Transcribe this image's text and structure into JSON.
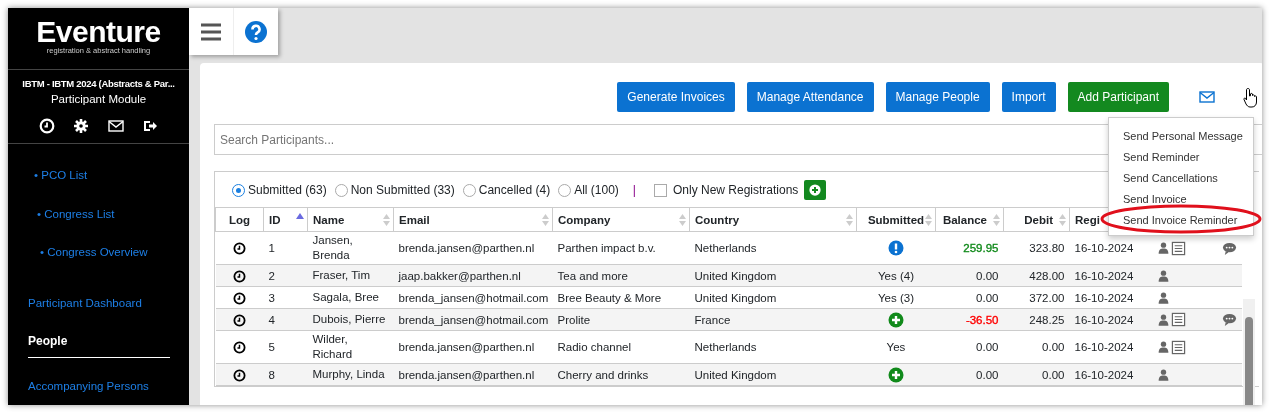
{
  "sidebar": {
    "logo": "Eventure",
    "tagline": "registration & abstract handling",
    "event": "IBTM - IBTM 2024 (Abstracts & Par...",
    "module": "Participant Module",
    "tree": [
      {
        "label": "• PCO List",
        "children": [
          {
            "label": "• Congress List",
            "children": [
              {
                "label": "• Congress Overview"
              }
            ]
          }
        ]
      }
    ],
    "menu": [
      {
        "label": "Participant Dashboard",
        "selected": false
      },
      {
        "label": "People",
        "selected": true
      },
      {
        "label": "Accompanying Persons",
        "selected": false
      }
    ]
  },
  "actions": [
    {
      "label": "Generate Invoices",
      "kind": "primary"
    },
    {
      "label": "Manage Attendance",
      "kind": "primary"
    },
    {
      "label": "Manage People",
      "kind": "primary"
    },
    {
      "label": "Import",
      "kind": "primary"
    },
    {
      "label": "Add Participant",
      "kind": "success"
    }
  ],
  "mail_menu": {
    "expanded": true,
    "items": [
      {
        "label": "Send Personal Message",
        "highlighted": false
      },
      {
        "label": "Send Reminder",
        "highlighted": false
      },
      {
        "label": "Send Cancellations",
        "highlighted": false
      },
      {
        "label": "Send Invoice",
        "highlighted": false
      },
      {
        "label": "Send Invoice Reminder",
        "highlighted": true
      }
    ]
  },
  "search": {
    "placeholder": "Search Participants..."
  },
  "filters": [
    {
      "label": "Submitted (63)",
      "selected": true
    },
    {
      "label": "Non Submitted (33)",
      "selected": false
    },
    {
      "label": "Cancelled (4)",
      "selected": false
    },
    {
      "label": "All (100)",
      "selected": false
    }
  ],
  "separator": "|",
  "new_only": {
    "label": "Only New Registrations",
    "checked": false
  },
  "table": {
    "columns": [
      {
        "label": "Log",
        "sortable": false
      },
      {
        "label": "ID",
        "sorted": true
      },
      {
        "label": "Name",
        "sortable": true
      },
      {
        "label": "Email",
        "sortable": true
      },
      {
        "label": "Company",
        "sortable": true
      },
      {
        "label": "Country",
        "sortable": true
      },
      {
        "label": "Submitted",
        "sortable": true
      },
      {
        "label": "Balance",
        "sortable": true
      },
      {
        "label": "Debit",
        "sortable": true
      },
      {
        "label": "Regi",
        "sortable": false
      }
    ],
    "rows": [
      {
        "id": "1",
        "name": "Jansen, Brenda",
        "email": "brenda.jansen@parthen.nl",
        "company": "Parthen impact b.v.",
        "country": "Netherlands",
        "submitted": {
          "kind": "alert"
        },
        "balance": {
          "text": "259.95",
          "color": "#118a1b"
        },
        "debit": "323.80",
        "registered": "16-10-2024",
        "has_form": true,
        "has_comment": true
      },
      {
        "id": "2",
        "name": "Fraser, Tim",
        "email": "jaap.bakker@parthen.nl",
        "company": "Tea and more",
        "country": "United Kingdom",
        "submitted": {
          "kind": "text",
          "text": "Yes (4)"
        },
        "balance": {
          "text": "0.00"
        },
        "debit": "428.00",
        "registered": "16-10-2024",
        "has_form": false,
        "has_comment": false
      },
      {
        "id": "3",
        "name": "Sagala, Bree",
        "email": "brenda_jansen@hotmail.com",
        "company": "Bree Beauty & More",
        "country": "United Kingdom",
        "submitted": {
          "kind": "text",
          "text": "Yes (3)"
        },
        "balance": {
          "text": "0.00"
        },
        "debit": "372.00",
        "registered": "16-10-2024",
        "has_form": false,
        "has_comment": false
      },
      {
        "id": "4",
        "name": "Dubois, Pierre",
        "email": "brenda_jansen@hotmail.com",
        "company": "Prolite",
        "country": "France",
        "submitted": {
          "kind": "plus"
        },
        "balance": {
          "text": "-36.50",
          "color": "#ff0000"
        },
        "debit": "248.25",
        "registered": "16-10-2024",
        "has_form": true,
        "has_comment": true
      },
      {
        "id": "5",
        "name": "Wilder, Richard",
        "email": "brenda.jansen@parthen.nl",
        "company": "Radio channel",
        "country": "Netherlands",
        "submitted": {
          "kind": "text",
          "text": "Yes"
        },
        "balance": {
          "text": "0.00"
        },
        "debit": "0.00",
        "registered": "16-10-2024",
        "has_form": true,
        "has_comment": false
      },
      {
        "id": "8",
        "name": "Murphy, Linda",
        "email": "brenda.jansen@parthen.nl",
        "company": "Cherry and drinks",
        "country": "United Kingdom",
        "submitted": {
          "kind": "plus"
        },
        "balance": {
          "text": "0.00"
        },
        "debit": "0.00",
        "registered": "16-10-2024",
        "has_form": false,
        "has_comment": false
      }
    ]
  }
}
